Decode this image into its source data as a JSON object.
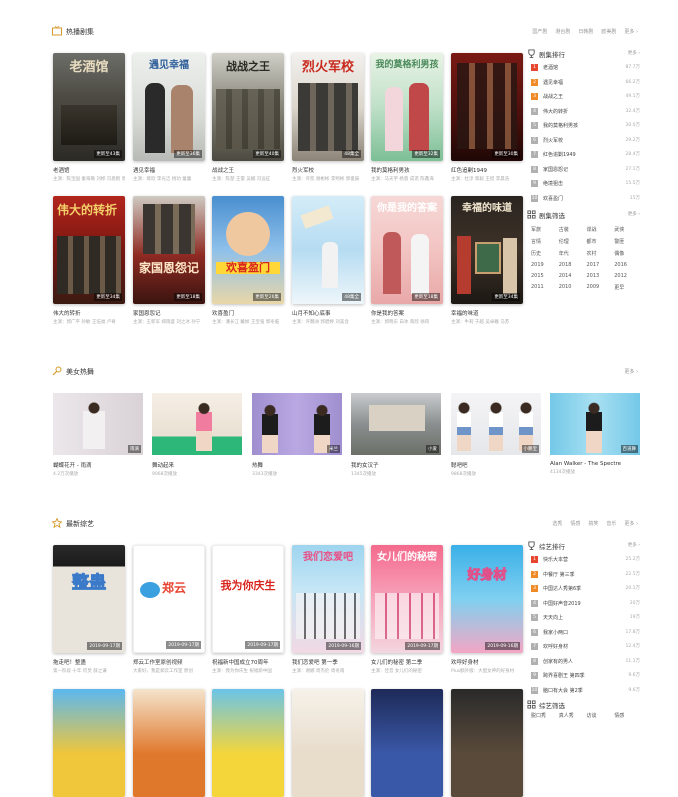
{
  "colors": {
    "accent": "#e6452e",
    "orange": "#f08a26",
    "gray": "#b0b0b0"
  },
  "drama": {
    "title": "热播剧集",
    "tabs": [
      "国产剧",
      "港台剧",
      "日韩剧",
      "欧美剧",
      "更多 ›"
    ],
    "items": [
      {
        "title": "老酒馆",
        "sub": "主演：陈宝国 秦海璐 刘桦 冯恩鹤 郭涛",
        "badge": "更新至43集",
        "poster": "老酒馆"
      },
      {
        "title": "遇见幸福",
        "sub": "主演：蒋欣 李光洁 杨玏 童蕾",
        "badge": "更新至36集",
        "poster": "遇见幸福"
      },
      {
        "title": "战战之王",
        "sub": "主演：陈楚 王雷 吴樾 冯远征",
        "badge": "更新至40集",
        "poster": "战战之王"
      },
      {
        "title": "烈火军校",
        "sub": "主演：许凯 谢彬彬 李熙彬 郭俊辰",
        "badge": "48集全",
        "poster": "烈火军校"
      },
      {
        "title": "我的莫格利男孩",
        "sub": "主演：马天宇 杨蓉 成诺 陈鑫海",
        "badge": "更新至32集",
        "poster": "我的莫格利男孩"
      },
      {
        "title": "红色追剿1949",
        "sub": "主演：杜淳 蒋毅 王挺 李晨浩",
        "badge": "更新至30集",
        "poster": ""
      },
      {
        "title": "伟大的转折",
        "sub": "主演：郭广平 孙敏 王伍福 卢奇",
        "badge": "更新至34集",
        "poster": "伟大的转折"
      },
      {
        "title": "家国恩怨记",
        "sub": "主演：王新军 郑雨盛 刘之冰 孙宁",
        "badge": "更新至18集",
        "poster": "家国恩怨记"
      },
      {
        "title": "欢喜盈门",
        "sub": "主演：潘长江 戴娇 王宝强 郭冬临",
        "badge": "更新至26集",
        "poster": "欢喜盈门"
      },
      {
        "title": "山月不知心底事",
        "sub": "主演：许魏洲 郭碧婷 刘美含",
        "badge": "48集全",
        "poster": ""
      },
      {
        "title": "你是我的答案",
        "sub": "主演：郭晓东 白冰 蒋欣 徐筠",
        "badge": "更新至18集",
        "poster": "你是我的答案"
      },
      {
        "title": "幸福的味道",
        "sub": "主演：牛莉 于越 吴卓羲 马苏",
        "badge": "更新至34集",
        "poster": "幸福的味道"
      }
    ]
  },
  "drama_rank": {
    "title": "剧集排行",
    "more": "更多 ›",
    "rows": [
      {
        "n": "1",
        "name": "老酒馆",
        "val": "87.7万"
      },
      {
        "n": "2",
        "name": "遇见幸福",
        "val": "66.2万"
      },
      {
        "n": "3",
        "name": "战战之王",
        "val": "49.1万"
      },
      {
        "n": "4",
        "name": "伟大的转折",
        "val": "32.4万"
      },
      {
        "n": "5",
        "name": "我的莫格利男孩",
        "val": "30.0万"
      },
      {
        "n": "6",
        "name": "烈火军校",
        "val": "29.2万"
      },
      {
        "n": "7",
        "name": "红色追剿1949",
        "val": "28.4万"
      },
      {
        "n": "8",
        "name": "家国恩怨记",
        "val": "27.1万"
      },
      {
        "n": "9",
        "name": "绝境狙击",
        "val": "15.5万"
      },
      {
        "n": "10",
        "name": "欢喜盈门",
        "val": "15万"
      }
    ]
  },
  "drama_filter": {
    "title": "剧集筛选",
    "more": "更多 ›",
    "items": [
      "军旅",
      "古装",
      "谍战",
      "武侠",
      "言情",
      "伦理",
      "都市",
      "警匪",
      "历史",
      "年代",
      "农村",
      "偶像",
      "2019",
      "2018",
      "2017",
      "2016",
      "2015",
      "2014",
      "2013",
      "2012",
      "2011",
      "2010",
      "2009",
      "更早"
    ]
  },
  "dance": {
    "title": "美女热舞",
    "more": "更多 ›",
    "items": [
      {
        "title": "蝴蝶花开 - 雨滴",
        "sub": "4.2万次播放",
        "badge": "雨滴"
      },
      {
        "title": "舞动起来",
        "sub": "9068次播放",
        "badge": ""
      },
      {
        "title": "热舞",
        "sub": "3343次播放",
        "badge": "米兰"
      },
      {
        "title": "我的女汉子",
        "sub": "1345次播放",
        "badge": "小爱"
      },
      {
        "title": "聪吧吧",
        "sub": "9868次播放",
        "badge": "小鹏宝"
      },
      {
        "title": "Alan Walker - The Spectre",
        "sub": "4134次播放",
        "badge": "百道舞"
      }
    ]
  },
  "variety": {
    "title": "最新综艺",
    "tabs": [
      "选秀",
      "情感",
      "搞笑",
      "音乐",
      "更多 ›"
    ],
    "items": [
      {
        "title": "拖走吧！整蛊",
        "sub": "第一阶段 十年 何炅 薛之谦",
        "badge": "2019-09-17期",
        "poster": "整蛊"
      },
      {
        "title": "郑云工作室原创视频",
        "sub": "大家好，我是郑云工作室 原创",
        "badge": "2019-09-17期",
        "poster": "郑云"
      },
      {
        "title": "祝福新中国成立70周年",
        "sub": "主演：我为你庆生 祝福新中国",
        "badge": "2019-09-17期",
        "poster": "我为你庆生"
      },
      {
        "title": "我们恋爱吧 第一季",
        "sub": "主演：谢娜 周杰伦 周冬雨",
        "badge": "2019-09-16期",
        "poster": "我们恋爱吧"
      },
      {
        "title": "女儿们的秘密 第二季",
        "sub": "主演：佳音 女儿们的秘密",
        "badge": "2019-09-17期",
        "poster": "女儿们的秘密"
      },
      {
        "title": "欢呼好身材",
        "sub": "Plus额外版：大胆女神的好身材",
        "badge": "2019-09-16期",
        "poster": "好身材"
      }
    ]
  },
  "variety_rank": {
    "title": "综艺排行",
    "more": "更多 ›",
    "rows": [
      {
        "n": "1",
        "name": "快乐大本营",
        "val": "25.2万"
      },
      {
        "n": "2",
        "name": "中餐厅 第三季",
        "val": "22.5万"
      },
      {
        "n": "3",
        "name": "中国达人秀第6季",
        "val": "20.1万"
      },
      {
        "n": "4",
        "name": "中国好声音2019",
        "val": "20万"
      },
      {
        "n": "5",
        "name": "天天向上",
        "val": "19万"
      },
      {
        "n": "6",
        "name": "我家小两口",
        "val": "17.8万"
      },
      {
        "n": "7",
        "name": "欢呼好身材",
        "val": "12.4万"
      },
      {
        "n": "8",
        "name": "创家有的男人",
        "val": "11.1万"
      },
      {
        "n": "9",
        "name": "跨界喜剧王 第四季",
        "val": "9.6万"
      },
      {
        "n": "10",
        "name": "脑口有大会 第2季",
        "val": "9.6万"
      }
    ]
  },
  "variety_filter": {
    "title": "综艺筛选",
    "items": [
      "脱口秀",
      "真人秀",
      "访谈",
      "情感"
    ]
  }
}
